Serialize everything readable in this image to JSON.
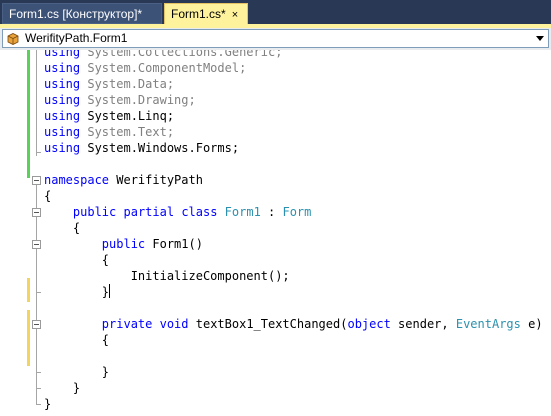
{
  "tabs": [
    {
      "label": "Form1.cs [Конструктор]*",
      "active": false
    },
    {
      "label": "Form1.cs*",
      "close": "×",
      "active": true
    }
  ],
  "nav": {
    "selected": "WerifityPath.Form1",
    "icon": "class-icon"
  },
  "colors": {
    "keyword": "#0000ff",
    "type": "#2b91af",
    "unused": "#808080",
    "tab_active": "#fff29d",
    "chrome": "#293955"
  },
  "code": {
    "lines": [
      [
        {
          "t": "using",
          "k": "kw"
        },
        {
          "t": " System.Collections.Generic;",
          "k": "gr"
        }
      ],
      [
        {
          "t": "using",
          "k": "kw"
        },
        {
          "t": " System.ComponentModel;",
          "k": "gr"
        }
      ],
      [
        {
          "t": "using",
          "k": "kw"
        },
        {
          "t": " System.Data;",
          "k": "gr"
        }
      ],
      [
        {
          "t": "using",
          "k": "kw"
        },
        {
          "t": " System.Drawing;",
          "k": "gr"
        }
      ],
      [
        {
          "t": "using",
          "k": "kw"
        },
        {
          "t": " System.Linq;"
        }
      ],
      [
        {
          "t": "using",
          "k": "kw"
        },
        {
          "t": " System.Text;",
          "k": "gr"
        }
      ],
      [
        {
          "t": "using",
          "k": "kw"
        },
        {
          "t": " System.Windows.Forms;"
        }
      ],
      [],
      [
        {
          "t": "namespace",
          "k": "kw"
        },
        {
          "t": " WerifityPath"
        }
      ],
      [
        {
          "t": "{"
        }
      ],
      [
        {
          "t": "    "
        },
        {
          "t": "public",
          "k": "kw"
        },
        {
          "t": " "
        },
        {
          "t": "partial",
          "k": "kw"
        },
        {
          "t": " "
        },
        {
          "t": "class",
          "k": "kw"
        },
        {
          "t": " "
        },
        {
          "t": "Form1",
          "k": "ty"
        },
        {
          "t": " : "
        },
        {
          "t": "Form",
          "k": "ty"
        }
      ],
      [
        {
          "t": "    {"
        }
      ],
      [
        {
          "t": "        "
        },
        {
          "t": "public",
          "k": "kw"
        },
        {
          "t": " Form1()"
        }
      ],
      [
        {
          "t": "        {"
        }
      ],
      [
        {
          "t": "            InitializeComponent();"
        }
      ],
      [
        {
          "t": "        }"
        },
        {
          "t": "",
          "k": "caret"
        }
      ],
      [],
      [
        {
          "t": "        "
        },
        {
          "t": "private",
          "k": "kw"
        },
        {
          "t": " "
        },
        {
          "t": "void",
          "k": "kw"
        },
        {
          "t": " textBox1_TextChanged("
        },
        {
          "t": "object",
          "k": "kw"
        },
        {
          "t": " sender, "
        },
        {
          "t": "EventArgs",
          "k": "ty"
        },
        {
          "t": " e)"
        }
      ],
      [
        {
          "t": "        {"
        }
      ],
      [],
      [
        {
          "t": "        }"
        }
      ],
      [
        {
          "t": "    }"
        }
      ],
      [
        {
          "t": "}"
        }
      ]
    ]
  }
}
